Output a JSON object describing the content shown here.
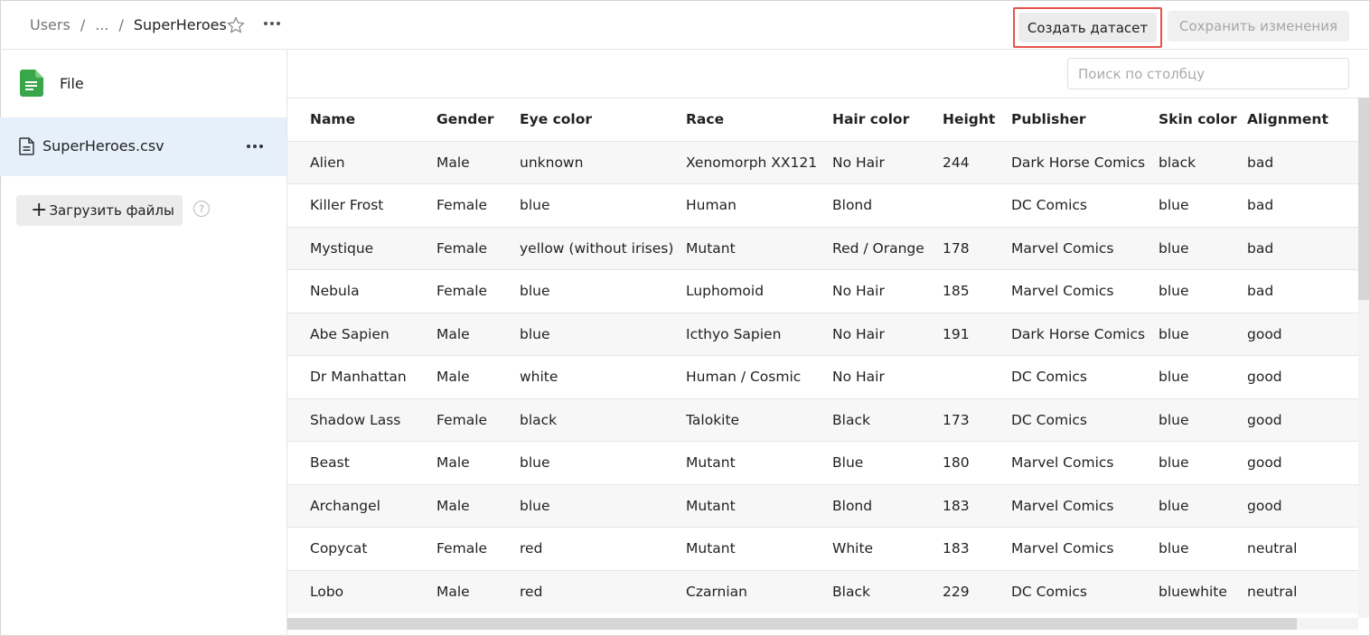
{
  "breadcrumbs": {
    "root": "Users",
    "sep": "/",
    "ellipsis": "...",
    "current": "SuperHeroes"
  },
  "toolbar": {
    "create_dataset": "Создать датасет",
    "save_changes": "Сохранить изменения"
  },
  "sidebar": {
    "file_header": "File",
    "file_name": "SuperHeroes.csv",
    "upload_label": "Загрузить файлы",
    "help": "?"
  },
  "search": {
    "placeholder": "Поиск по столбцу"
  },
  "colors": {
    "accent_outline": "#e8524a",
    "file_icon": "#3aa64a",
    "selected_bg": "#e6f0fb"
  },
  "table": {
    "columns": [
      "Name",
      "Gender",
      "Eye color",
      "Race",
      "Hair color",
      "Height",
      "Publisher",
      "Skin color",
      "Alignment"
    ],
    "rows": [
      [
        "Alien",
        "Male",
        "unknown",
        "Xenomorph XX121",
        "No Hair",
        "244",
        "Dark Horse Comics",
        "black",
        "bad"
      ],
      [
        "Killer Frost",
        "Female",
        "blue",
        "Human",
        "Blond",
        "",
        "DC Comics",
        "blue",
        "bad"
      ],
      [
        "Mystique",
        "Female",
        "yellow (without irises)",
        "Mutant",
        "Red / Orange",
        "178",
        "Marvel Comics",
        "blue",
        "bad"
      ],
      [
        "Nebula",
        "Female",
        "blue",
        "Luphomoid",
        "No Hair",
        "185",
        "Marvel Comics",
        "blue",
        "bad"
      ],
      [
        "Abe Sapien",
        "Male",
        "blue",
        "Icthyo Sapien",
        "No Hair",
        "191",
        "Dark Horse Comics",
        "blue",
        "good"
      ],
      [
        "Dr Manhattan",
        "Male",
        "white",
        "Human / Cosmic",
        "No Hair",
        "",
        "DC Comics",
        "blue",
        "good"
      ],
      [
        "Shadow Lass",
        "Female",
        "black",
        "Talokite",
        "Black",
        "173",
        "DC Comics",
        "blue",
        "good"
      ],
      [
        "Beast",
        "Male",
        "blue",
        "Mutant",
        "Blue",
        "180",
        "Marvel Comics",
        "blue",
        "good"
      ],
      [
        "Archangel",
        "Male",
        "blue",
        "Mutant",
        "Blond",
        "183",
        "Marvel Comics",
        "blue",
        "good"
      ],
      [
        "Copycat",
        "Female",
        "red",
        "Mutant",
        "White",
        "183",
        "Marvel Comics",
        "blue",
        "neutral"
      ],
      [
        "Lobo",
        "Male",
        "red",
        "Czarnian",
        "Black",
        "229",
        "DC Comics",
        "bluewhite",
        "neutral"
      ]
    ]
  },
  "icons": {
    "star": "star-icon",
    "more": "more-horizontal-icon",
    "file": "spreadsheet-file-icon",
    "doc": "document-icon",
    "upload": "plus-icon",
    "help": "help-icon"
  }
}
